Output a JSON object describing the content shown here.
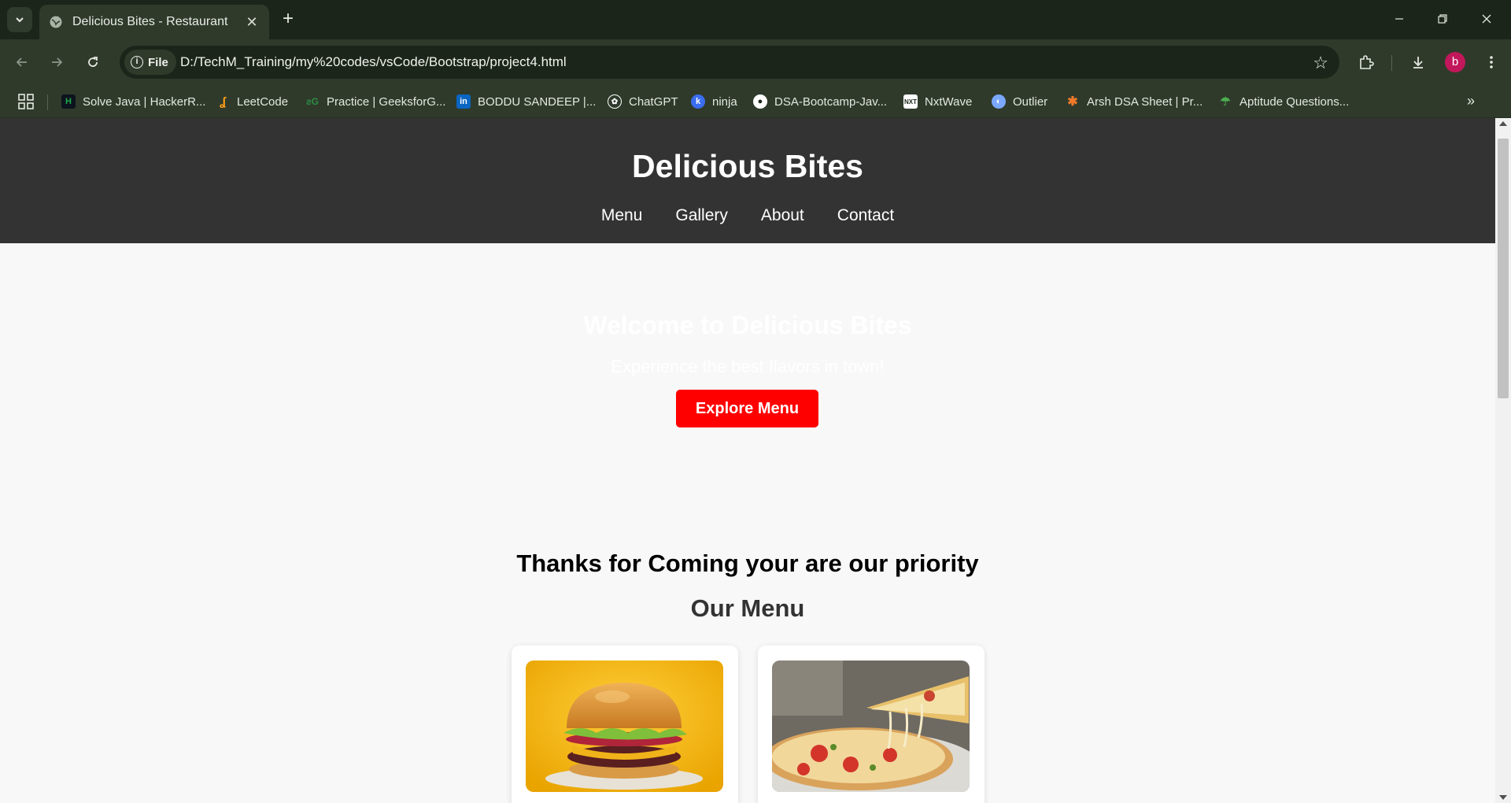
{
  "browser": {
    "tab_title": "Delicious Bites - Restaurant",
    "url_scheme_chip": "File",
    "url": "D:/TechM_Training/my%20codes/vsCode/Bootstrap/project4.html",
    "profile_initial": "b",
    "bookmarks": [
      {
        "label": "Solve Java | HackerR...",
        "icon": "hackerrank-icon",
        "color": "#1ba94c"
      },
      {
        "label": "LeetCode",
        "icon": "leetcode-icon",
        "color": "#ffa116"
      },
      {
        "label": "Practice | GeeksforG...",
        "icon": "geeksforgeeks-icon",
        "color": "#2f8d46"
      },
      {
        "label": "BODDU SANDEEP |...",
        "icon": "linkedin-icon",
        "color": "#0a66c2"
      },
      {
        "label": "ChatGPT",
        "icon": "chatgpt-icon",
        "color": "#ffffff"
      },
      {
        "label": "ninja",
        "icon": "ninja-icon",
        "color": "#3a6df0"
      },
      {
        "label": "DSA-Bootcamp-Jav...",
        "icon": "github-icon",
        "color": "#ffffff"
      },
      {
        "label": "NxtWave",
        "icon": "nxtwave-icon",
        "color": "#ffffff"
      },
      {
        "label": "Outlier",
        "icon": "outlier-icon",
        "color": "#7aa7ff"
      },
      {
        "label": "Arsh DSA Sheet | Pr...",
        "icon": "arsh-dsa-icon",
        "color": "#f07a2a"
      },
      {
        "label": "Aptitude Questions...",
        "icon": "aptitude-icon",
        "color": "#4caf50"
      }
    ]
  },
  "site": {
    "brand": "Delicious Bites",
    "nav": [
      "Menu",
      "Gallery",
      "About",
      "Contact"
    ],
    "hero": {
      "heading": "Welcome to Delicious Bites",
      "subtitle": "Experience the best flavors in town!",
      "button": "Explore Menu"
    },
    "priority_text": "Thanks for Coming your are our priority",
    "menu_title": "Our Menu",
    "menu_items": [
      {
        "image": "burger-photo"
      },
      {
        "image": "pizza-photo"
      }
    ]
  },
  "colors": {
    "header_bg": "#333333",
    "accent_button": "#ff0000",
    "page_bg": "#f8f8f8"
  }
}
